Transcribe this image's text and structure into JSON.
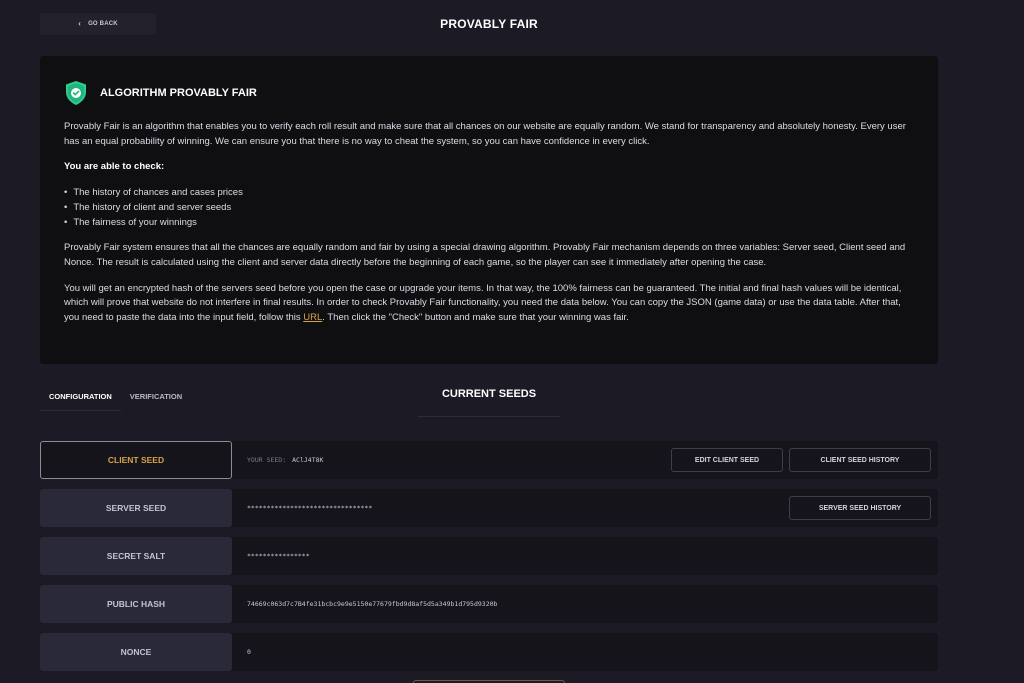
{
  "header": {
    "back_label": "GO BACK",
    "title": "PROVABLY FAIR"
  },
  "info": {
    "title": "ALGORITHM PROVABLY FAIR",
    "para1": "Provably Fair is an algorithm that enables you to verify each roll result and make sure that all chances on our website are equally random. We stand for transparency and absolutely honesty. Every user has an equal probability of winning. We can ensure you that there is no way to cheat the system, so you can have confidence in every click.",
    "check_heading": "You are able to check:",
    "check_items": [
      "The history of chances and cases prices",
      "The history of client and server seeds",
      "The fairness of your winnings"
    ],
    "para2": "Provably Fair system ensures that all the chances are equally random and fair by using a special drawing algorithm. Provably Fair mechanism depends on three variables: Server seed, Client seed and Nonce. The result is calculated using the client and server data directly before the beginning of each game, so the player can see it immediately after opening the case.",
    "para3_before_link": "You will get an encrypted hash of the servers seed before you open the case or upgrade your items. In that way, the 100% fairness can be guaranteed. The initial and final hash values will be identical, which will prove that website do not interfere in final results. In order to check Provably Fair functionality, you need the data below. You can copy the JSON (game data) or use the data table. After that, you need to paste the data into the input field, follow this ",
    "para3_link": "URL",
    "para3_after_link": ". Then click the \"Check\" button and make sure that your winning was fair."
  },
  "tabs": [
    {
      "label": "CONFIGURATION",
      "active": true
    },
    {
      "label": "VERIFICATION",
      "active": false
    }
  ],
  "seeds_heading": "CURRENT SEEDS",
  "rows": {
    "client_seed": {
      "label": "CLIENT SEED",
      "value_prefix": "YOUR SEED:",
      "value": "AClJ4T8K",
      "edit_button": "EDIT CLIENT SEED",
      "history_button": "CLIENT SEED HISTORY"
    },
    "server_seed": {
      "label": "SERVER SEED",
      "value": "********************************",
      "history_button": "SERVER SEED HISTORY"
    },
    "secret_salt": {
      "label": "SECRET SALT",
      "value": "****************"
    },
    "public_hash": {
      "label": "PUBLIC HASH",
      "value": "74669c063d7c7B4fe31bcbc9e9e5150e77679fbd9d8af5d5a349b1d795d9320b"
    },
    "nonce": {
      "label": "NONCE",
      "value": "0"
    }
  },
  "colors": {
    "background": "#1c1b25",
    "panel": "#0f0f12",
    "accent": "#d8a24a",
    "shield": "#2ecc8f"
  }
}
